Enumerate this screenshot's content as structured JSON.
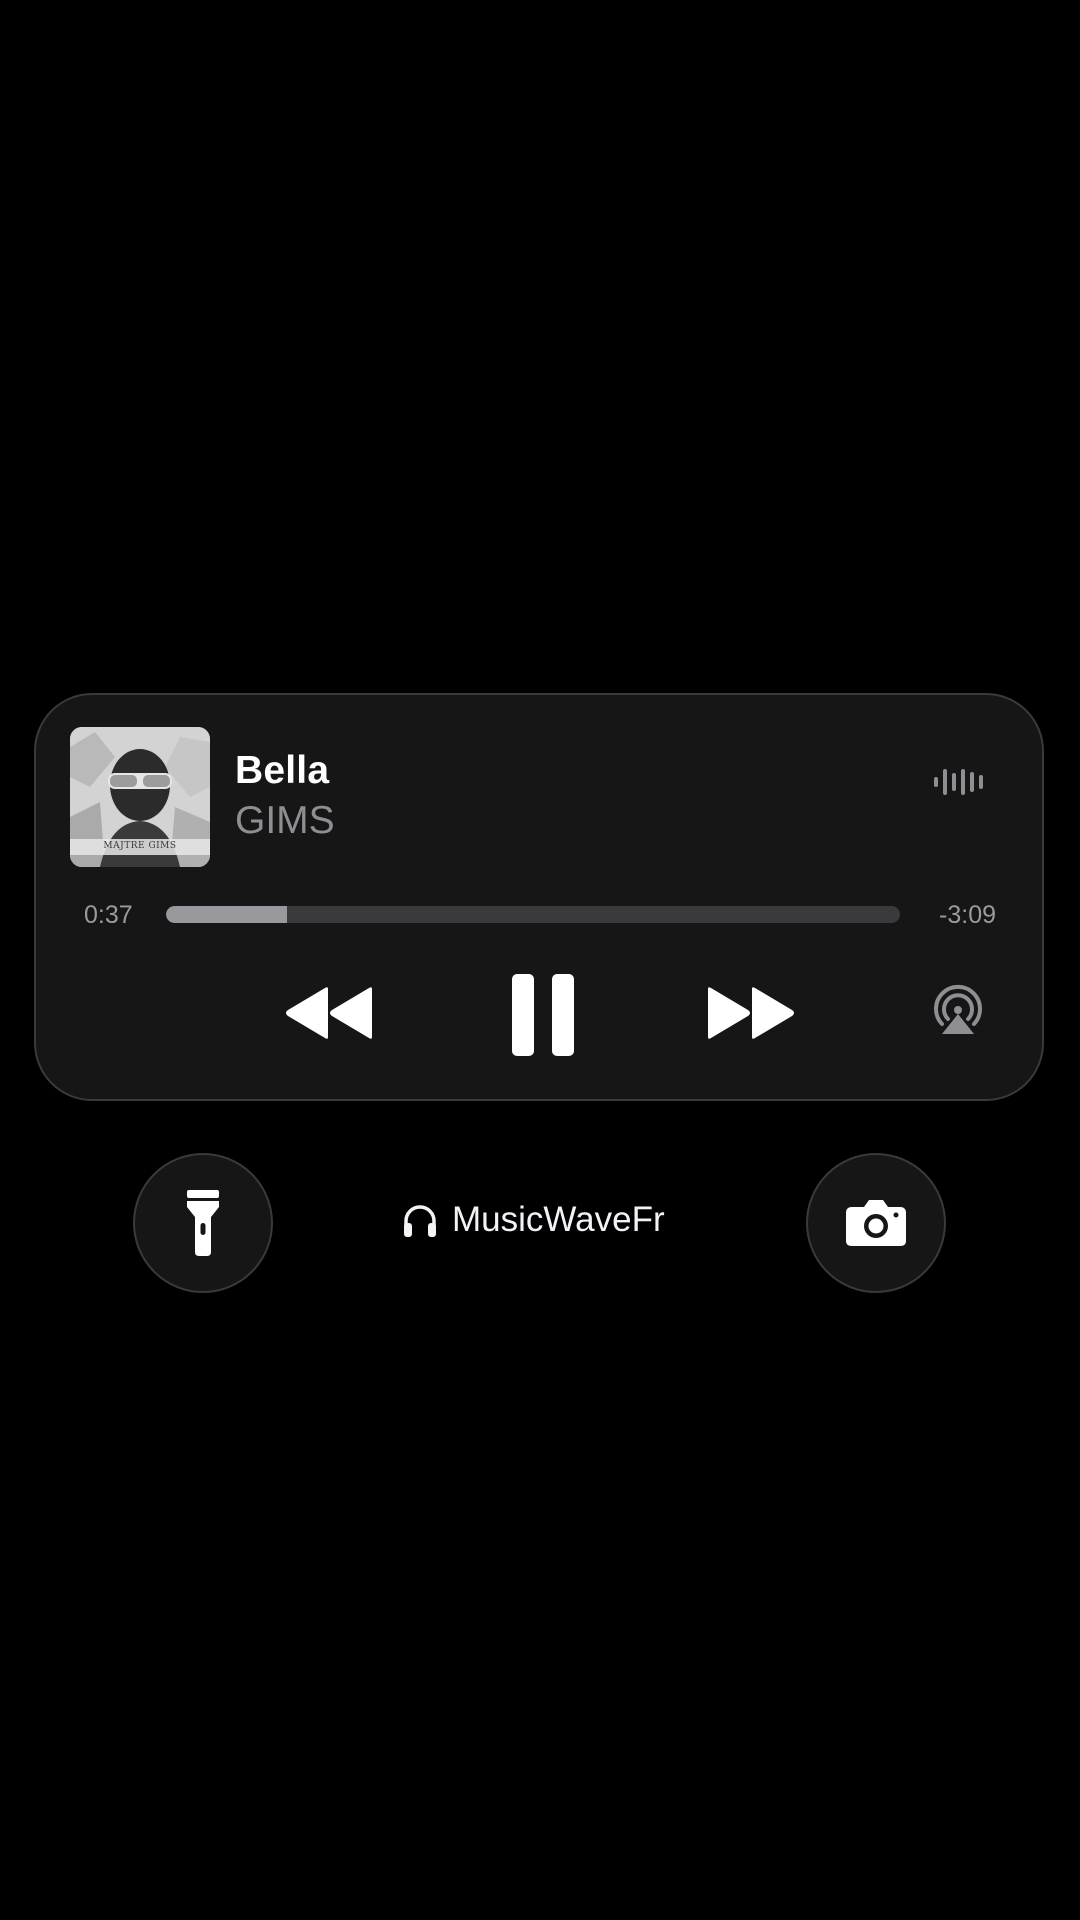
{
  "now_playing": {
    "title": "Bella",
    "artist": "GIMS",
    "album_art_caption": "MAJTRE GIMS",
    "elapsed": "0:37",
    "remaining": "-3:09",
    "progress_fraction": 0.165
  },
  "controls": {
    "rewind_icon": "rewind-icon",
    "pause_icon": "pause-icon",
    "forward_icon": "fast-forward-icon",
    "airplay_icon": "airplay-icon",
    "waveform_icon": "audio-waveform-icon"
  },
  "shortcuts": {
    "left_icon": "flashlight-icon",
    "right_icon": "camera-icon"
  },
  "watermark": {
    "icon": "headphones-icon",
    "text": "MusicWaveFr"
  },
  "colors": {
    "background": "#000000",
    "panel": "#161617",
    "panel_border": "#3a3a3c",
    "primary_text": "#ffffff",
    "secondary_text": "#8e8e93",
    "progress_fill": "#98989d",
    "progress_track": "#3a3a3c"
  }
}
